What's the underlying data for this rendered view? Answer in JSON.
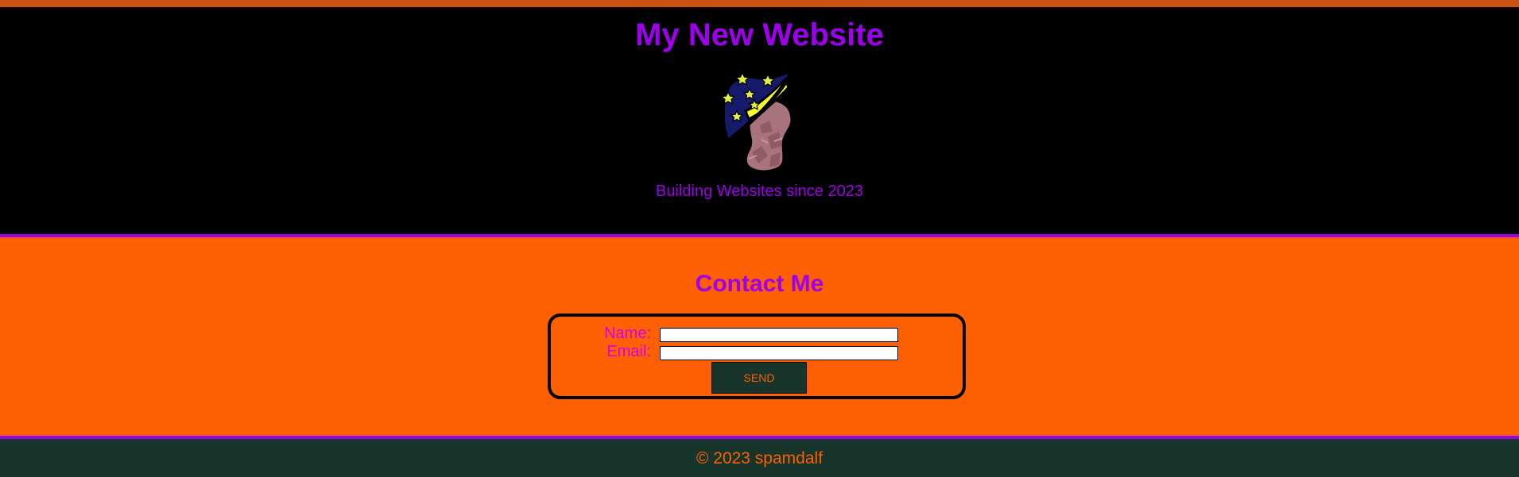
{
  "header": {
    "title": "My New Website",
    "tagline": "Building Websites since 2023",
    "logo_icon": "wizard-hat-logo-icon"
  },
  "contact": {
    "heading": "Contact Me",
    "name_label": "Name:",
    "name_value": "",
    "email_label": "Email:",
    "email_value": "",
    "send_label": "Send"
  },
  "footer": {
    "copyright": "© 2023 spamdalf"
  },
  "colors": {
    "accent_purple": "#9d00ec",
    "orange": "#fe5f00",
    "dark_green": "#18352c",
    "black": "#000000"
  }
}
